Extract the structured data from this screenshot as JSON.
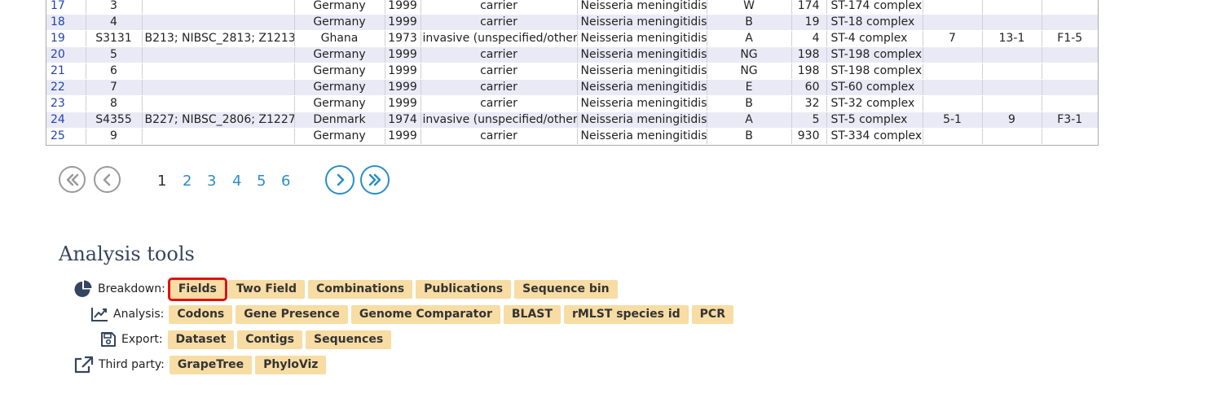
{
  "table": {
    "rows": [
      {
        "id": "17",
        "isolate": "3",
        "aliases": "",
        "country": "Germany",
        "year": "1999",
        "disease": "carrier",
        "species": "Neisseria meningitidis",
        "serogroup": "W",
        "st": "174",
        "clonal_complex": "ST-174 complex",
        "pora_vr1": "",
        "pora_vr2": "",
        "feta_vr": ""
      },
      {
        "id": "18",
        "isolate": "4",
        "aliases": "",
        "country": "Germany",
        "year": "1999",
        "disease": "carrier",
        "species": "Neisseria meningitidis",
        "serogroup": "B",
        "st": "19",
        "clonal_complex": "ST-18 complex",
        "pora_vr1": "",
        "pora_vr2": "",
        "feta_vr": ""
      },
      {
        "id": "19",
        "isolate": "S3131",
        "aliases": "B213; NIBSC_2813; Z1213",
        "country": "Ghana",
        "year": "1973",
        "disease": "invasive (unspecified/other)",
        "species": "Neisseria meningitidis",
        "serogroup": "A",
        "st": "4",
        "clonal_complex": "ST-4 complex",
        "pora_vr1": "7",
        "pora_vr2": "13-1",
        "feta_vr": "F1-5"
      },
      {
        "id": "20",
        "isolate": "5",
        "aliases": "",
        "country": "Germany",
        "year": "1999",
        "disease": "carrier",
        "species": "Neisseria meningitidis",
        "serogroup": "NG",
        "st": "198",
        "clonal_complex": "ST-198 complex",
        "pora_vr1": "",
        "pora_vr2": "",
        "feta_vr": ""
      },
      {
        "id": "21",
        "isolate": "6",
        "aliases": "",
        "country": "Germany",
        "year": "1999",
        "disease": "carrier",
        "species": "Neisseria meningitidis",
        "serogroup": "NG",
        "st": "198",
        "clonal_complex": "ST-198 complex",
        "pora_vr1": "",
        "pora_vr2": "",
        "feta_vr": ""
      },
      {
        "id": "22",
        "isolate": "7",
        "aliases": "",
        "country": "Germany",
        "year": "1999",
        "disease": "carrier",
        "species": "Neisseria meningitidis",
        "serogroup": "E",
        "st": "60",
        "clonal_complex": "ST-60 complex",
        "pora_vr1": "",
        "pora_vr2": "",
        "feta_vr": ""
      },
      {
        "id": "23",
        "isolate": "8",
        "aliases": "",
        "country": "Germany",
        "year": "1999",
        "disease": "carrier",
        "species": "Neisseria meningitidis",
        "serogroup": "B",
        "st": "32",
        "clonal_complex": "ST-32 complex",
        "pora_vr1": "",
        "pora_vr2": "",
        "feta_vr": ""
      },
      {
        "id": "24",
        "isolate": "S4355",
        "aliases": "B227; NIBSC_2806; Z1227",
        "country": "Denmark",
        "year": "1974",
        "disease": "invasive (unspecified/other)",
        "species": "Neisseria meningitidis",
        "serogroup": "A",
        "st": "5",
        "clonal_complex": "ST-5 complex",
        "pora_vr1": "5-1",
        "pora_vr2": "9",
        "feta_vr": "F3-1"
      },
      {
        "id": "25",
        "isolate": "9",
        "aliases": "",
        "country": "Germany",
        "year": "1999",
        "disease": "carrier",
        "species": "Neisseria meningitidis",
        "serogroup": "B",
        "st": "930",
        "clonal_complex": "ST-334 complex",
        "pora_vr1": "",
        "pora_vr2": "",
        "feta_vr": ""
      }
    ]
  },
  "pagination": {
    "pages": [
      "1",
      "2",
      "3",
      "4",
      "5",
      "6"
    ],
    "current_page": "1"
  },
  "analysis": {
    "title": "Analysis tools",
    "breakdown": {
      "label": "Breakdown:",
      "icon": "pie-chart-icon",
      "buttons": [
        "Fields",
        "Two Field",
        "Combinations",
        "Publications",
        "Sequence bin"
      ]
    },
    "analysis": {
      "label": "Analysis:",
      "icon": "line-chart-icon",
      "buttons": [
        "Codons",
        "Gene Presence",
        "Genome Comparator",
        "BLAST",
        "rMLST species id",
        "PCR"
      ]
    },
    "export": {
      "label": "Export:",
      "icon": "save-icon",
      "buttons": [
        "Dataset",
        "Contigs",
        "Sequences"
      ]
    },
    "third_party": {
      "label": "Third party:",
      "icon": "external-link-icon",
      "buttons": [
        "GrapeTree",
        "PhyloViz"
      ]
    }
  },
  "colors": {
    "button_bg": "#f7dca4",
    "highlight": "#e01010",
    "link": "#2a8ec8",
    "row_alt": "#eaeaf7"
  }
}
